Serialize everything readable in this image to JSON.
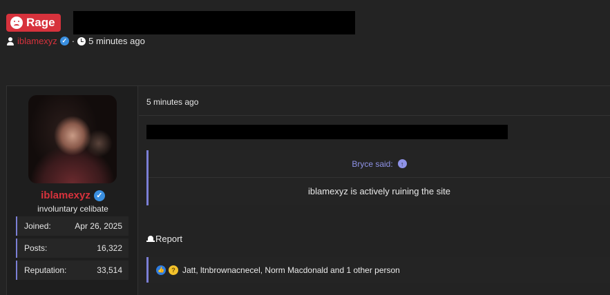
{
  "thread": {
    "prefix": "Rage",
    "author": "iblamexyz",
    "separator": "·",
    "posted": "5 minutes ago"
  },
  "user": {
    "name": "iblamexyz",
    "title": "involuntary celibate",
    "stats": [
      {
        "label": "Joined:",
        "value": "Apr 26, 2025"
      },
      {
        "label": "Posts:",
        "value": "16,322"
      },
      {
        "label": "Reputation:",
        "value": "33,514"
      }
    ]
  },
  "post": {
    "time": "5 minutes ago",
    "quote": {
      "author_line": "Bryce said:",
      "text": "iblamexyz is actively ruining the site"
    },
    "report_label": "Report",
    "reactions_text": "Jatt, ltnbrownacnecel, Norm Macdonald and 1 other person"
  },
  "colors": {
    "prefix_bg": "#d7323c",
    "username": "#d7323c",
    "accent_border": "#7b7fd6",
    "verified": "#3a8fe0"
  },
  "icons": [
    "rage-face-icon",
    "person-icon",
    "verified-icon",
    "clock-icon",
    "arrow-up-icon",
    "bell-icon",
    "like-icon",
    "thinking-face-icon"
  ]
}
